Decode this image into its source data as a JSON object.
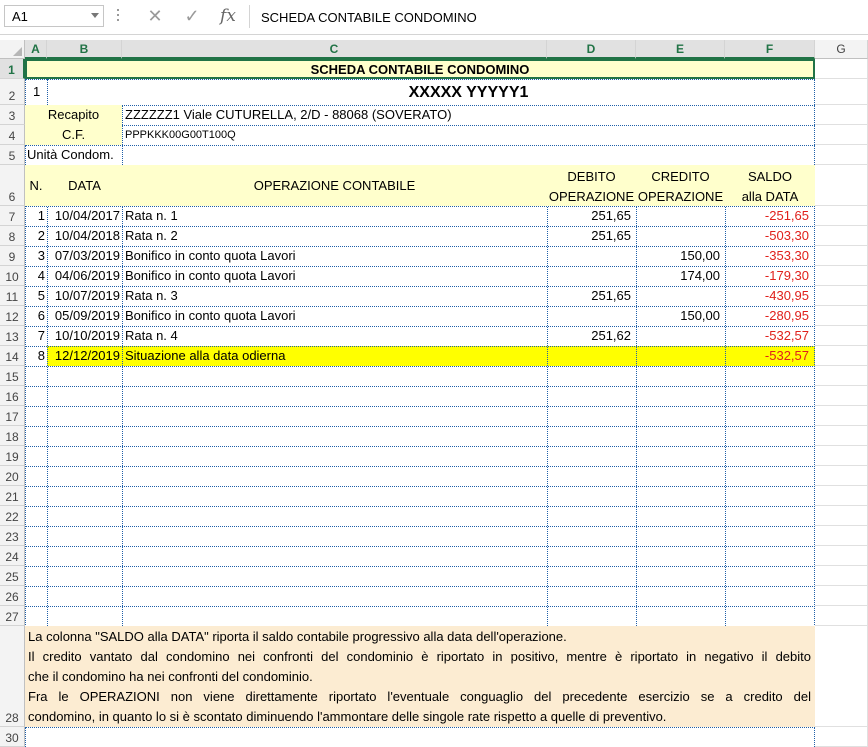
{
  "formula_bar": {
    "name_box": "A1",
    "content": "SCHEDA CONTABILE CONDOMINO",
    "cancel_icon": "close-icon",
    "enter_icon": "check-icon",
    "function_icon": "fx"
  },
  "columns": [
    "A",
    "B",
    "C",
    "D",
    "E",
    "F",
    "G"
  ],
  "rows": [
    "1",
    "2",
    "3",
    "4",
    "5",
    "6",
    "7",
    "8",
    "9",
    "10",
    "11",
    "12",
    "13",
    "14",
    "15",
    "16",
    "17",
    "18",
    "19",
    "20",
    "21",
    "22",
    "23",
    "24",
    "25",
    "26",
    "27",
    "28",
    "30"
  ],
  "sheet": {
    "title": "SCHEDA CONTABILE CONDOMINO",
    "row2_index": "1",
    "name": "XXXXX YYYYY1",
    "recapito_label": "Recapito",
    "recapito_value": "ZZZZZZ1    Viale CUTURELLA, 2/D - 88068 (SOVERATO)",
    "cf_label": "C.F.",
    "cf_value": "PPPKKK00G00T100Q",
    "unita_label": "Unità Condom.",
    "headers": {
      "n": "N.",
      "data": "DATA",
      "operazione": "OPERAZIONE CONTABILE",
      "debito_1": "DEBITO",
      "debito_2": "OPERAZIONE",
      "credito_1": "CREDITO",
      "credito_2": "OPERAZIONE",
      "saldo_1": "SALDO",
      "saldo_2": "alla DATA"
    },
    "entries": [
      {
        "n": "1",
        "data": "10/04/2017",
        "op": "Rata n. 1",
        "debito": "251,65",
        "credito": "",
        "saldo": "-251,65"
      },
      {
        "n": "2",
        "data": "10/04/2018",
        "op": "Rata n. 2",
        "debito": "251,65",
        "credito": "",
        "saldo": "-503,30"
      },
      {
        "n": "3",
        "data": "07/03/2019",
        "op": "Bonifico in conto quota Lavori",
        "debito": "",
        "credito": "150,00",
        "saldo": "-353,30"
      },
      {
        "n": "4",
        "data": "04/06/2019",
        "op": "Bonifico in conto quota Lavori",
        "debito": "",
        "credito": "174,00",
        "saldo": "-179,30"
      },
      {
        "n": "5",
        "data": "10/07/2019",
        "op": "Rata n. 3",
        "debito": "251,65",
        "credito": "",
        "saldo": "-430,95"
      },
      {
        "n": "6",
        "data": "05/09/2019",
        "op": "Bonifico in conto quota Lavori",
        "debito": "",
        "credito": "150,00",
        "saldo": "-280,95"
      },
      {
        "n": "7",
        "data": "10/10/2019",
        "op": "Rata n. 4",
        "debito": "251,62",
        "credito": "",
        "saldo": "-532,57"
      },
      {
        "n": "8",
        "data": "12/12/2019",
        "op": "Situazione alla data odierna",
        "debito": "",
        "credito": "",
        "saldo": "-532,57"
      }
    ],
    "note_lines": [
      "La colonna \"SALDO alla DATA\" riporta il saldo contabile progressivo alla data dell'operazione.",
      "Il credito vantato dal condomino nei confronti del condominio è riportato in positivo, mentre è riportato in negativo il debito",
      "che il condomino ha nei confronti del condominio.",
      "Fra le OPERAZIONI non viene direttamente riportato l'eventuale conguaglio del precedente esercizio se a credito del",
      "condomino, in quanto lo si è scontato diminuendo l'ammontare delle singole rate rispetto a quelle di preventivo."
    ]
  },
  "colors": {
    "label_fill": "#ffffcc",
    "highlight_fill": "#ffff00",
    "note_fill": "#fcecd2",
    "negative": "#e0201b",
    "selection": "#217346"
  }
}
